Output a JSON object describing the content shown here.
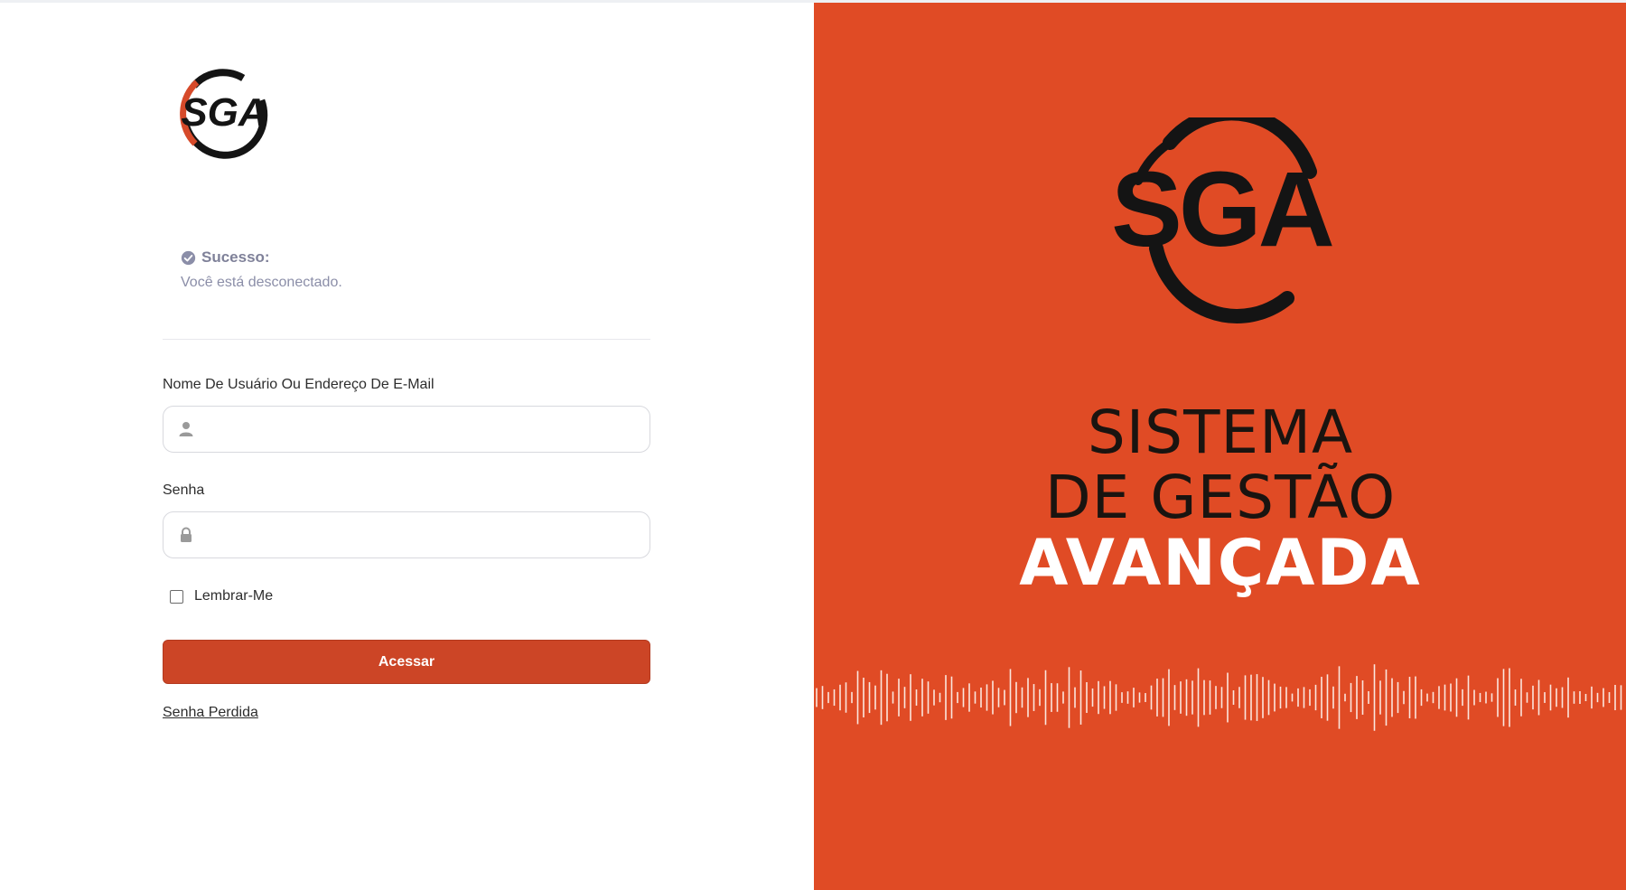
{
  "brand": {
    "logo_text": "SGA",
    "accent_color": "#e04b25",
    "button_color": "#cc4526"
  },
  "notice": {
    "icon": "check-circle-icon",
    "title": "Sucesso:",
    "message": "Você está desconectado."
  },
  "form": {
    "username_label": "Nome De Usuário Ou Endereço De E-Mail",
    "username_value": "",
    "username_icon": "user-icon",
    "password_label": "Senha",
    "password_value": "",
    "password_icon": "lock-icon",
    "remember_label": "Lembrar-Me",
    "remember_checked": false,
    "submit_label": "Acessar",
    "lost_password_label": "Senha Perdida"
  },
  "hero": {
    "line1": "SISTEMA",
    "line2": "DE GESTÃO",
    "line3": "AVANÇADA"
  }
}
